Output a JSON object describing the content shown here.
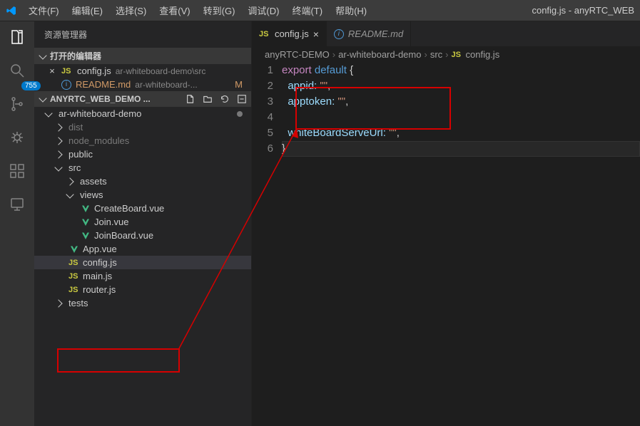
{
  "window_title": "config.js - anyRTC_WEB",
  "menubar": [
    "文件(F)",
    "编辑(E)",
    "选择(S)",
    "查看(V)",
    "转到(G)",
    "调试(D)",
    "终端(T)",
    "帮助(H)"
  ],
  "sidebar_title": "资源管理器",
  "open_editors_label": "打开的编辑器",
  "open_editors": [
    {
      "icon": "js",
      "name": "config.js",
      "path": "ar-whiteboard-demo\\src",
      "close": "×",
      "status": ""
    },
    {
      "icon": "info",
      "name": "README.md",
      "path": "ar-whiteboard-...",
      "close": "",
      "status": "M"
    }
  ],
  "project_name": "ANYRTC_WEB_DEMO ...",
  "tree": {
    "root": "ar-whiteboard-demo",
    "items": [
      {
        "type": "folder",
        "name": "dist",
        "ind": 28,
        "dim": true,
        "open": false
      },
      {
        "type": "folder",
        "name": "node_modules",
        "ind": 28,
        "dim": true,
        "open": false
      },
      {
        "type": "folder",
        "name": "public",
        "ind": 28,
        "open": false
      },
      {
        "type": "folder",
        "name": "src",
        "ind": 28,
        "open": true
      },
      {
        "type": "folder",
        "name": "assets",
        "ind": 44,
        "open": false
      },
      {
        "type": "folder",
        "name": "views",
        "ind": 44,
        "open": true
      },
      {
        "type": "vue",
        "name": "CreateBoard.vue",
        "ind": 64
      },
      {
        "type": "vue",
        "name": "Join.vue",
        "ind": 64
      },
      {
        "type": "vue",
        "name": "JoinBoard.vue",
        "ind": 64
      },
      {
        "type": "vue",
        "name": "App.vue",
        "ind": 48
      },
      {
        "type": "js",
        "name": "config.js",
        "ind": 48,
        "sel": true
      },
      {
        "type": "js",
        "name": "main.js",
        "ind": 48
      },
      {
        "type": "js",
        "name": "router.js",
        "ind": 48
      },
      {
        "type": "folder",
        "name": "tests",
        "ind": 28,
        "open": false
      }
    ]
  },
  "tabs": [
    {
      "icon": "js",
      "label": "config.js",
      "active": true
    },
    {
      "icon": "info",
      "label": "README.md",
      "active": false
    }
  ],
  "breadcrumb": [
    "anyRTC-DEMO",
    "ar-whiteboard-demo",
    "src",
    "config.js"
  ],
  "code": {
    "lines": [
      1,
      2,
      3,
      4,
      5,
      6
    ],
    "l1": {
      "kw": "export",
      "dflt": "default",
      "brace": "{"
    },
    "l2": {
      "prop": "appid:",
      "str": "\"\"",
      "comma": ","
    },
    "l3": {
      "prop": "apptoken:",
      "str": "\"\"",
      "comma": ","
    },
    "l5": {
      "prop": "whiteBoardServeUrl:",
      "str": "\"\"",
      "comma": ","
    },
    "l6": {
      "brace": "}"
    }
  },
  "badge": "755"
}
